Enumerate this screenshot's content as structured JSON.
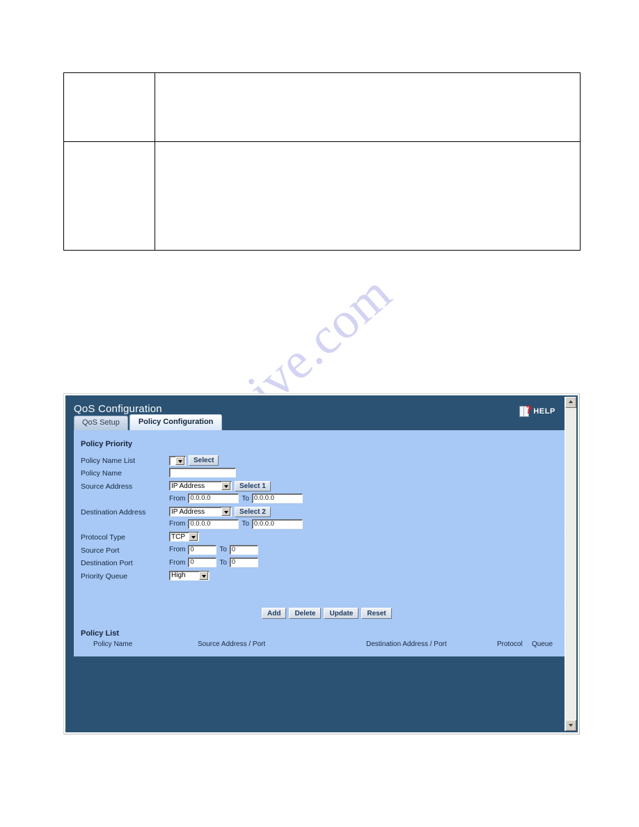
{
  "watermark": {
    "text": "manualshive.com"
  },
  "document_table": {
    "rows": [
      {
        "cells": [
          "",
          ""
        ]
      },
      {
        "cells": [
          "",
          ""
        ]
      }
    ]
  },
  "device_ui": {
    "title": "QoS Configuration",
    "help": {
      "label": "HELP",
      "icon": "help-book-icon"
    },
    "tabs": [
      {
        "label": "QoS Setup",
        "active": false
      },
      {
        "label": "Policy Configuration",
        "active": true
      }
    ],
    "sections": {
      "policy_priority_title": "Policy Priority",
      "policy_list_title": "Policy List"
    },
    "fields": {
      "policy_name_list": {
        "label": "Policy Name List",
        "select_value": "",
        "button": "Select"
      },
      "policy_name": {
        "label": "Policy Name",
        "value": ""
      },
      "source_address": {
        "label": "Source Address",
        "type_value": "IP Address",
        "button": "Select 1",
        "from_label": "From",
        "from_value": "0.0.0.0",
        "to_label": "To",
        "to_value": "0.0.0.0"
      },
      "destination_address": {
        "label": "Destination Address",
        "type_value": "IP Address",
        "button": "Select 2",
        "from_label": "From",
        "from_value": "0.0.0.0",
        "to_label": "To",
        "to_value": "0.0.0.0"
      },
      "protocol_type": {
        "label": "Protocol Type",
        "value": "TCP"
      },
      "source_port": {
        "label": "Source Port",
        "from_label": "From",
        "from_value": "0",
        "to_label": "To",
        "to_value": "0"
      },
      "destination_port": {
        "label": "Destination Port",
        "from_label": "From",
        "from_value": "0",
        "to_label": "To",
        "to_value": "0"
      },
      "priority_queue": {
        "label": "Priority Queue",
        "value": "High"
      }
    },
    "actions": [
      {
        "label": "Add"
      },
      {
        "label": "Delete"
      },
      {
        "label": "Update"
      },
      {
        "label": "Reset"
      }
    ],
    "policy_list": {
      "columns": [
        "Policy Name",
        "Source Address / Port",
        "Destination Address / Port",
        "Protocol",
        "Queue"
      ],
      "rows": []
    },
    "colors": {
      "header_bg": "#2b5272",
      "panel_bg": "#a8c8f5",
      "active_tab_text": "#10253c",
      "help_question_mark": "#e21b1b",
      "watermark": "#ccccf2"
    }
  }
}
